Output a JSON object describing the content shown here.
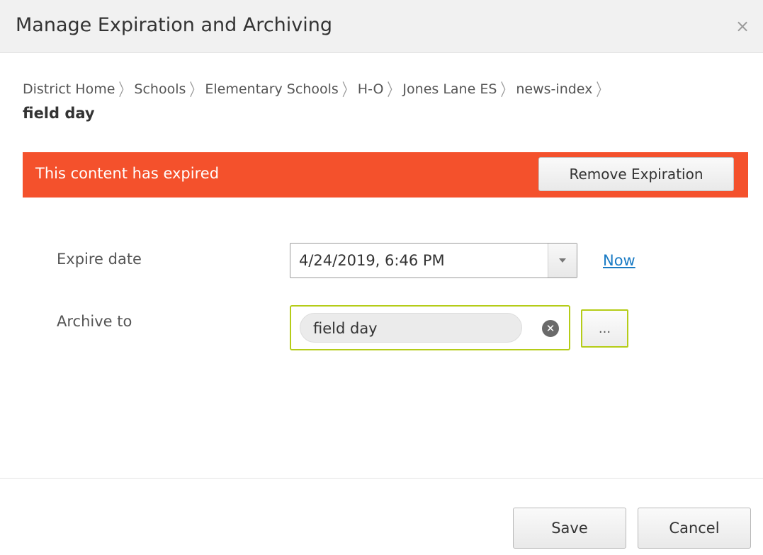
{
  "dialog": {
    "title": "Manage Expiration and Archiving",
    "close_glyph": "×"
  },
  "breadcrumb": {
    "items": [
      "District Home",
      "Schools",
      "Elementary Schools",
      "H-O",
      "Jones Lane ES",
      "news-index"
    ],
    "separator": "〉",
    "current": "field day"
  },
  "alert": {
    "message": "This content has expired",
    "action_label": "Remove Expiration",
    "color": "#f4512c"
  },
  "form": {
    "expire_label": "Expire date",
    "expire_value": "4/24/2019, 6:46 PM",
    "now_label": "Now",
    "archive_label": "Archive to",
    "archive_value": "field day",
    "browse_label": "...",
    "focus_color": "#b5cc18"
  },
  "footer": {
    "save_label": "Save",
    "cancel_label": "Cancel"
  },
  "icons": {
    "close": "close-icon",
    "dropdown": "chevron-down-icon",
    "clear": "clear-circle-icon"
  }
}
